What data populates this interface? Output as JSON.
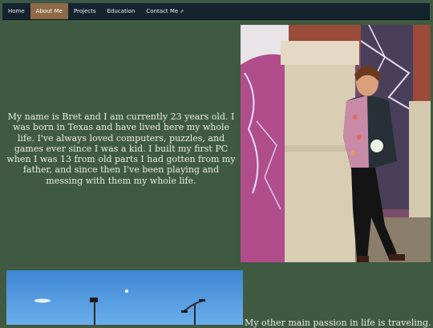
{
  "nav": {
    "items": [
      {
        "label": "Home",
        "active": false
      },
      {
        "label": "About Me",
        "active": true
      },
      {
        "label": "Projects",
        "active": false
      },
      {
        "label": "Education",
        "active": false
      },
      {
        "label": "Contact Me",
        "active": false,
        "icon": "external-link-icon"
      }
    ]
  },
  "about": {
    "intro": "My name is Bret and I am currently 23 years old. I was born in Texas and have lived here my whole life. I've always loved computers, puzzles, and games ever since I was a kid. I built my first PC when I was 13 from old parts I had gotten from my father, and since then I've been playing and messing with them my whole life.",
    "second_paragraph_start": "My other main passion in life is traveling. I"
  },
  "colors": {
    "page_background": "#3f5a40",
    "nav_background": "#15232f",
    "nav_active": "#8f6a47",
    "text": "#e8ece6"
  }
}
